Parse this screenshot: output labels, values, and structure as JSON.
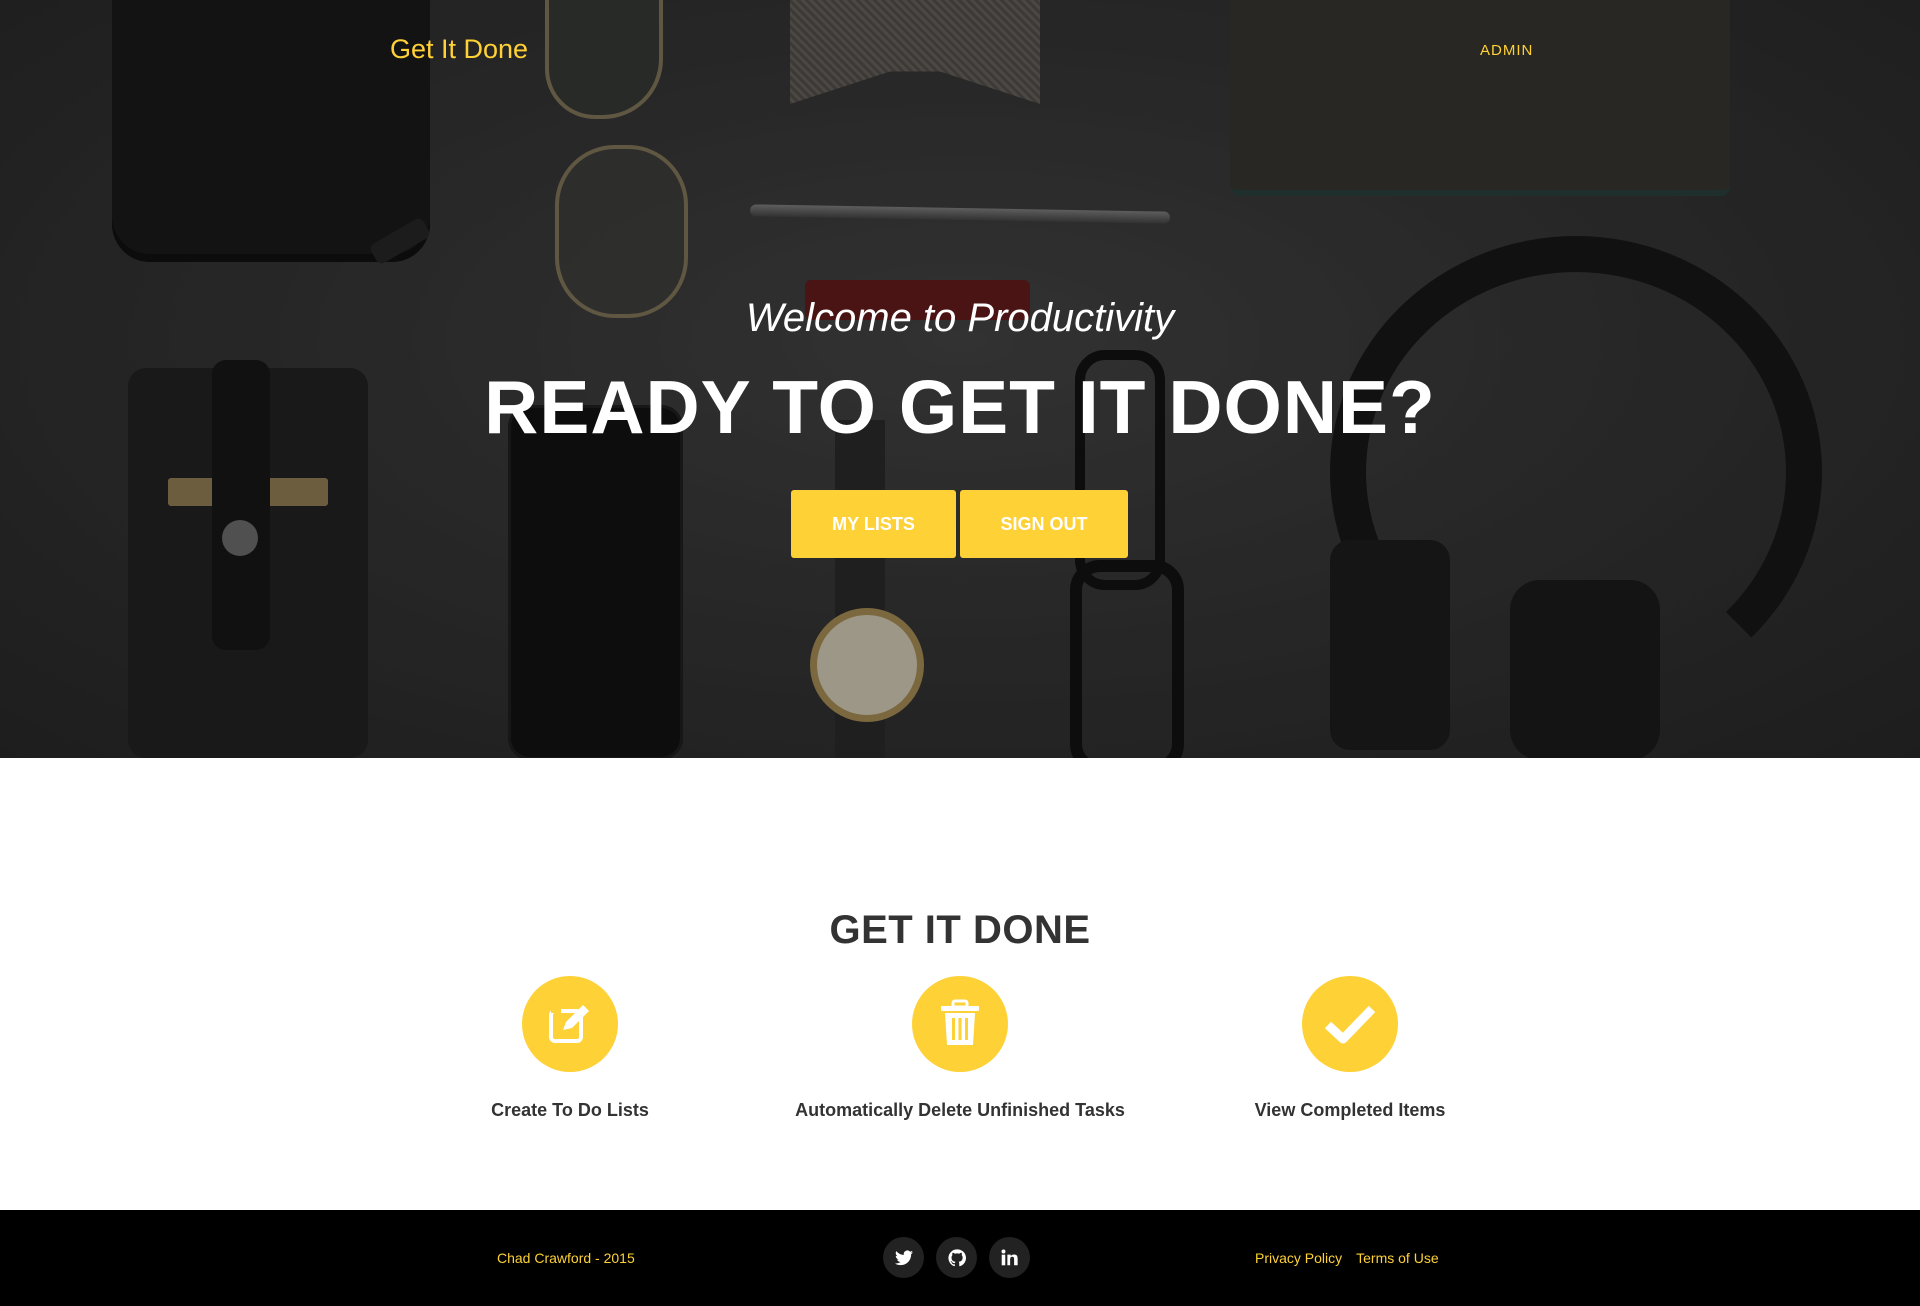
{
  "nav": {
    "brand": "Get It Done",
    "admin_link": "ADMIN"
  },
  "hero": {
    "lead": "Welcome to Productivity",
    "heading": "READY TO GET IT DONE?",
    "buttons": {
      "my_lists": "MY LISTS",
      "sign_out": "SIGN OUT"
    }
  },
  "services": {
    "heading": "GET IT DONE",
    "features": [
      {
        "icon": "edit-icon",
        "label": "Create To Do Lists"
      },
      {
        "icon": "trash-icon",
        "label": "Automatically Delete Unfinished Tasks"
      },
      {
        "icon": "check-icon",
        "label": "View Completed Items"
      }
    ]
  },
  "footer": {
    "copyright": "Chad Crawford - 2015",
    "socials": [
      "twitter-icon",
      "github-icon",
      "linkedin-icon"
    ],
    "links": {
      "privacy": "Privacy Policy",
      "terms": "Terms of Use"
    }
  },
  "colors": {
    "accent": "#fed136",
    "footer_bg": "#000000",
    "text_dark": "#333333"
  }
}
